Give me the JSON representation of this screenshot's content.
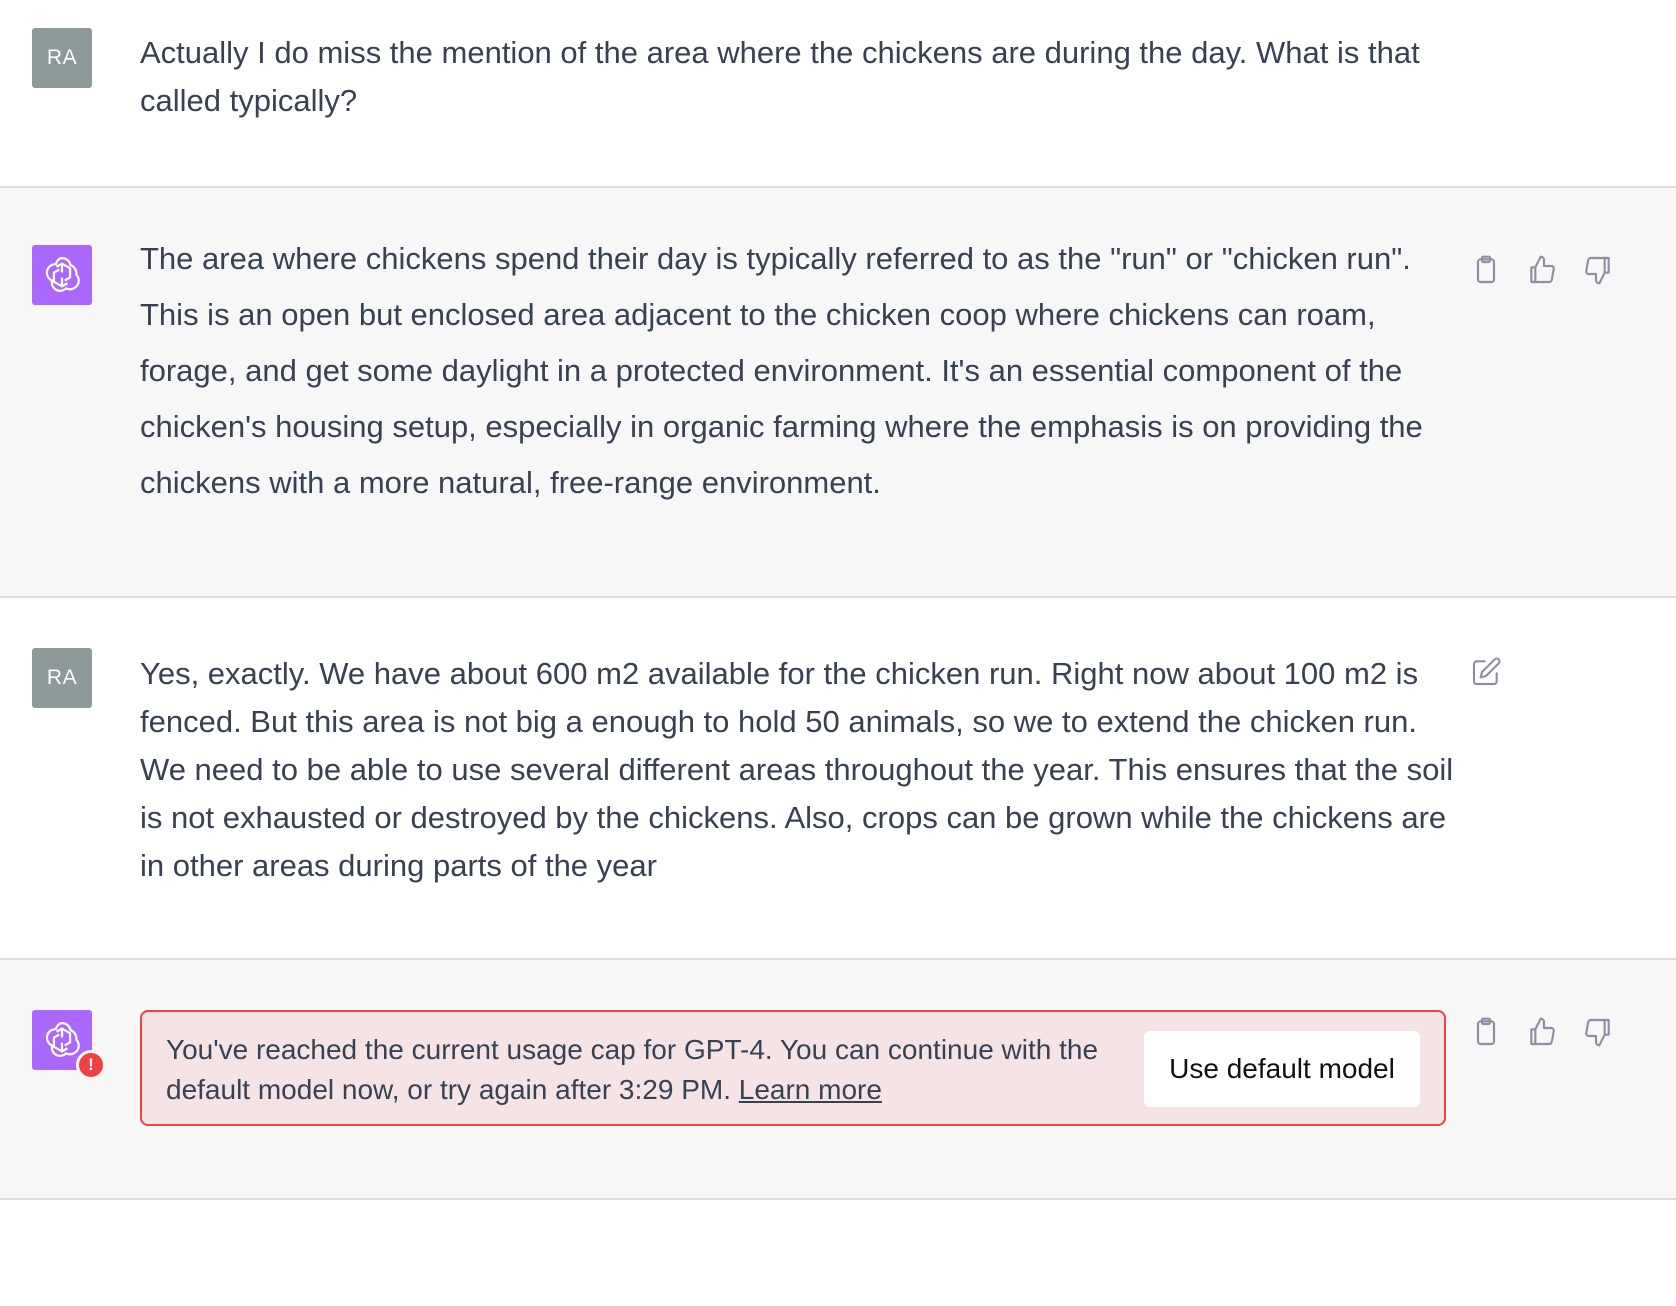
{
  "messages": [
    {
      "role": "user",
      "avatar_initials": "RA",
      "text": "Actually I do miss the mention of the area where the chickens are during the day. What is that called typically?"
    },
    {
      "role": "assistant",
      "text": "The area where chickens spend their day is typically referred to as the \"run\" or \"chicken run\". This is an open but enclosed area adjacent to the chicken coop where chickens can roam, forage, and get some daylight in a protected environment. It's an essential component of the chicken's housing setup, especially in organic farming where the emphasis is on providing the chickens with a more natural, free-range environment.",
      "actions": [
        "copy-icon",
        "thumbs-up-icon",
        "thumbs-down-icon"
      ]
    },
    {
      "role": "user",
      "avatar_initials": "RA",
      "text": "Yes, exactly. We have about 600 m2 available for the chicken run. Right now about 100 m2 is fenced. But this area is not big a enough to hold 50 animals, so we to extend the chicken run. We need to be able to use several different areas throughout the year. This ensures that the soil is not exhausted or destroyed by the chickens. Also, crops can be grown while the chickens are in other areas during parts of the year",
      "actions": [
        "edit-icon"
      ]
    },
    {
      "role": "assistant",
      "error": {
        "badge": "!",
        "message": "You've reached the current usage cap for GPT-4. You can continue with the default model now, or try again after 3:29 PM.",
        "link_text": "Learn more",
        "button_label": "Use default model"
      },
      "actions": [
        "copy-icon",
        "thumbs-up-icon",
        "thumbs-down-icon"
      ]
    }
  ],
  "colors": {
    "user_bg": "#ffffff",
    "assistant_bg": "#f7f7f8",
    "user_avatar": "#8e9a9a",
    "assistant_avatar": "#ab68ff",
    "error_border": "#ef4146",
    "error_bg": "#f5e3e5"
  }
}
